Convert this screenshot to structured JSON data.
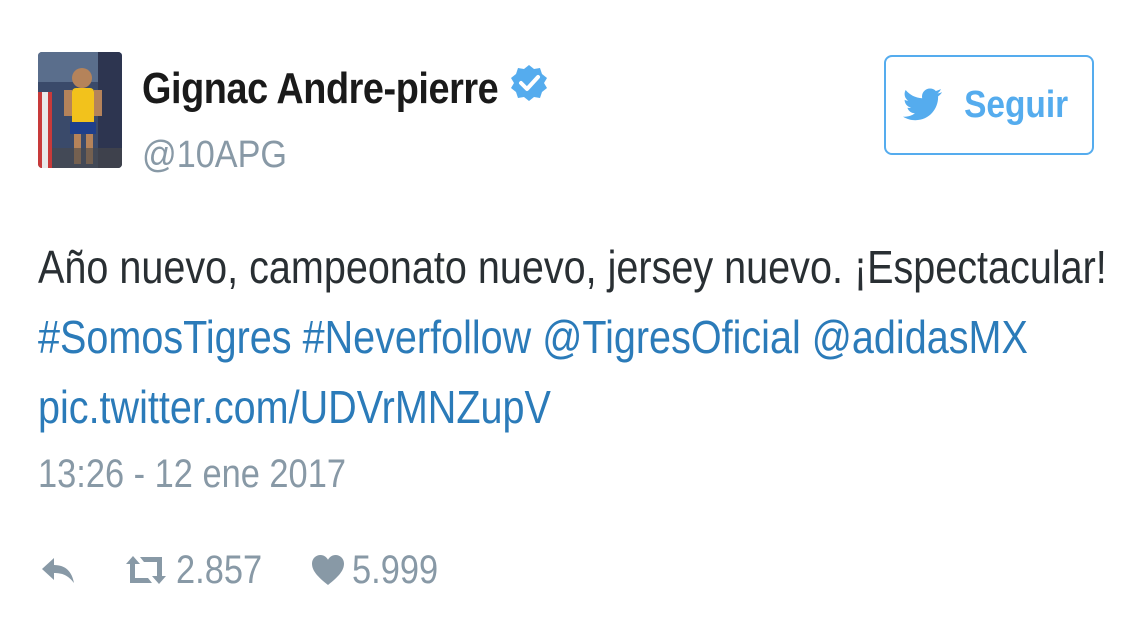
{
  "user": {
    "display_name": "Gignac Andre-pierre",
    "handle": "@10APG",
    "verified": true
  },
  "follow_button": {
    "label": "Seguir"
  },
  "tweet": {
    "text_line1": "Año nuevo, campeonato nuevo, jersey nuevo. ¡Espectacular!",
    "hashtag1": "#SomosTigres",
    "hashtag2": "#Neverfollow",
    "mention1": "@TigresOficial",
    "mention2": "@adidasMX",
    "pic_link": "pic.twitter.com/UDVrMNZupV",
    "timestamp": "13:26 - 12 ene 2017"
  },
  "stats": {
    "retweets": "2.857",
    "likes": "5.999"
  },
  "icons": {
    "verified": "verified-badge-icon",
    "follow": "twitter-bird-icon",
    "reply": "reply-icon",
    "retweet": "retweet-icon",
    "like": "heart-icon"
  },
  "colors": {
    "accent": "#55acee",
    "link": "#2b7bb9",
    "muted": "#8899a6",
    "text": "#292f33"
  }
}
